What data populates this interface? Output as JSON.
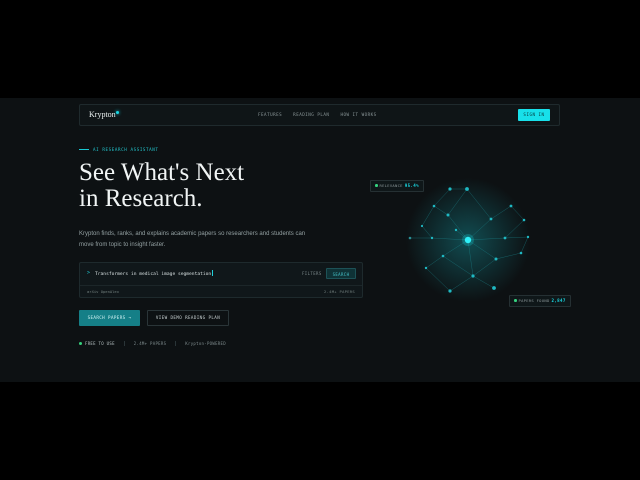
{
  "nav": {
    "logo": "Krypton",
    "links": [
      "FEATURES",
      "READING PLAN",
      "HOW IT WORKS"
    ],
    "signin": "SIGN IN"
  },
  "hero": {
    "eyebrow": "AI RESEARCH ASSISTANT",
    "headline_line1": "See What's Next",
    "headline_line2": "in Research.",
    "subtitle": "Krypton finds, ranks, and explains academic papers so researchers and students can move from topic to insight faster."
  },
  "search": {
    "prompt": ">",
    "query": "Transformers in medical image segmentation",
    "filters_label": "FILTERS",
    "search_label": "SEARCH",
    "sources": "arXiv   OpenAlex",
    "count": "2.4M+ PAPERS"
  },
  "actions": {
    "primary": "SEARCH PAPERS →",
    "secondary": "VIEW DEMO READING PLAN"
  },
  "meta": {
    "free": "FREE TO USE",
    "papers": "2.4M+ PAPERS",
    "powered": "Krypton-POWERED"
  },
  "viz": {
    "relevance_label": "RELEVANCE",
    "relevance_value": "95.4%",
    "found_label": "PAPERS FOUND",
    "found_value": "2,847"
  },
  "colors": {
    "accent": "#18e0ea",
    "background": "#0d1113",
    "status_green": "#36d27f"
  }
}
